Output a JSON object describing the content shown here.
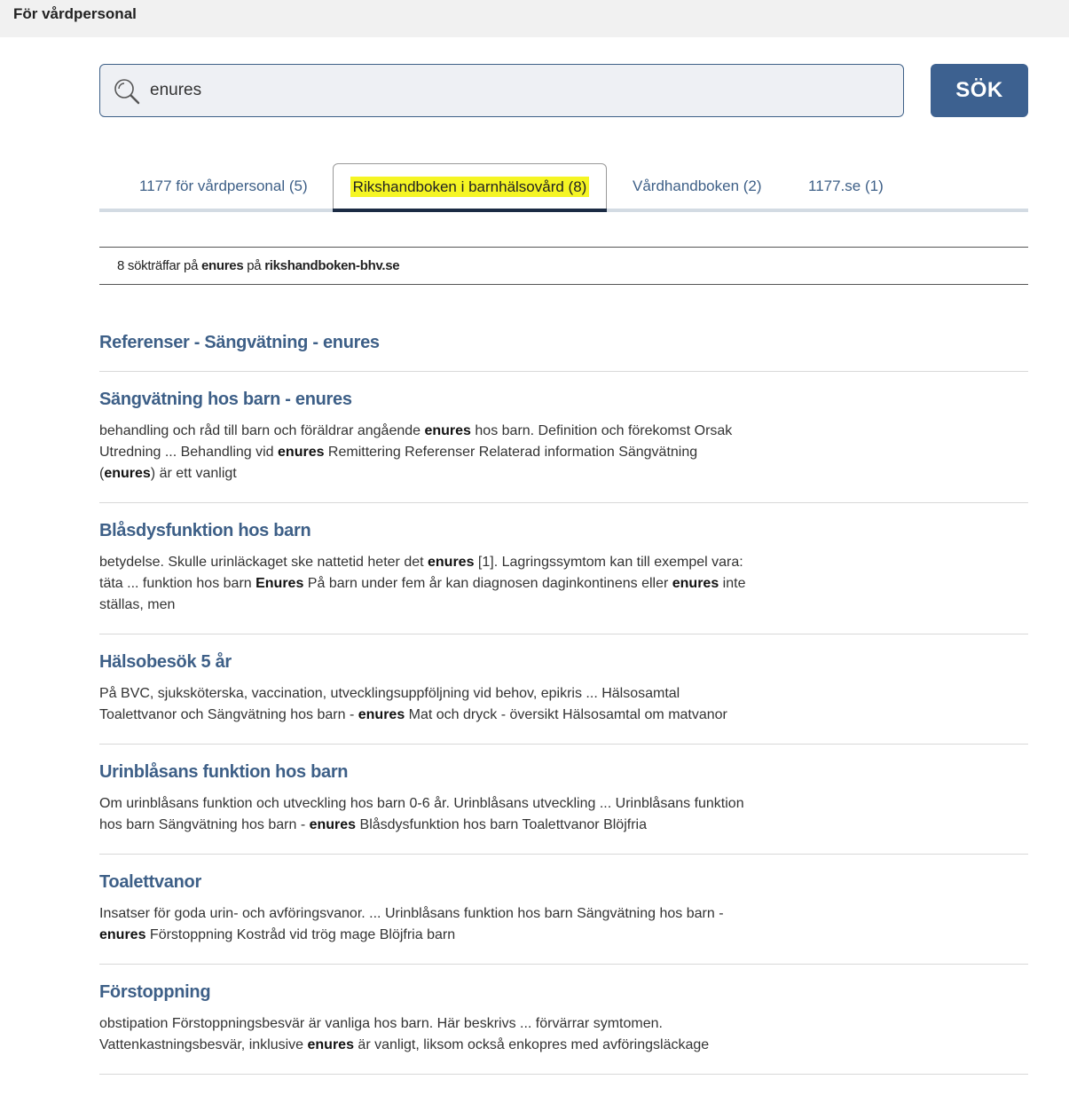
{
  "header": {
    "title": "För vårdpersonal"
  },
  "search": {
    "value": "enures",
    "button_label": "SÖK"
  },
  "tabs": [
    {
      "label": "1177 för vårdpersonal (5)"
    },
    {
      "label": "Rikshandboken i barnhälsovård (8)"
    },
    {
      "label": "Vårdhandboken (2)"
    },
    {
      "label": "1177.se (1)"
    }
  ],
  "summary": {
    "count": "8 sökträffar på",
    "term": "enures",
    "on": "på",
    "site": "rikshandboken-bhv.se"
  },
  "results": [
    {
      "title": "Referenser - Sängvätning - enures",
      "description": ""
    },
    {
      "title": "Sängvätning hos barn - enures",
      "description": "behandling och råd till barn och föräldrar angående **enures** hos barn. Definition och förekomst Orsak Utredning ... Behandling vid **enures** Remittering Referenser Relaterad information Sängvätning (**enures**) är ett vanligt"
    },
    {
      "title": "Blåsdysfunktion hos barn",
      "description": "betydelse. Skulle urinläckaget ske nattetid heter det **enures** [1]. Lagringssymtom kan till exempel vara: täta ... funktion hos barn **Enures** På barn under fem år kan diagnosen daginkontinens eller **enures** inte ställas, men"
    },
    {
      "title": "Hälsobesök 5 år",
      "description": "På BVC, sjuksköterska, vaccination, utvecklingsuppföljning vid behov, epikris ... Hälsosamtal Toalettvanor och Sängvätning hos barn - **enures** Mat och dryck - översikt Hälsosamtal om matvanor"
    },
    {
      "title": "Urinblåsans funktion hos barn",
      "description": "Om urinblåsans funktion och utveckling hos barn 0-6 år. Urinblåsans utveckling ... Urinblåsans funktion hos barn Sängvätning hos barn - **enures** Blåsdysfunktion hos barn Toalettvanor Blöjfria"
    },
    {
      "title": "Toalettvanor",
      "description": "Insatser för goda urin- och avföringsvanor. ... Urinblåsans funktion hos barn Sängvätning hos barn - **enures** Förstoppning Kostråd vid trög mage Blöjfria barn"
    },
    {
      "title": "Förstoppning",
      "description": "obstipation Förstoppningsbesvär är vanliga hos barn. Här beskrivs ... förvärrar symtomen. Vattenkastningsbesvär, inklusive **enures** är vanligt, liksom också enkopres med avföringsläckage"
    }
  ]
}
